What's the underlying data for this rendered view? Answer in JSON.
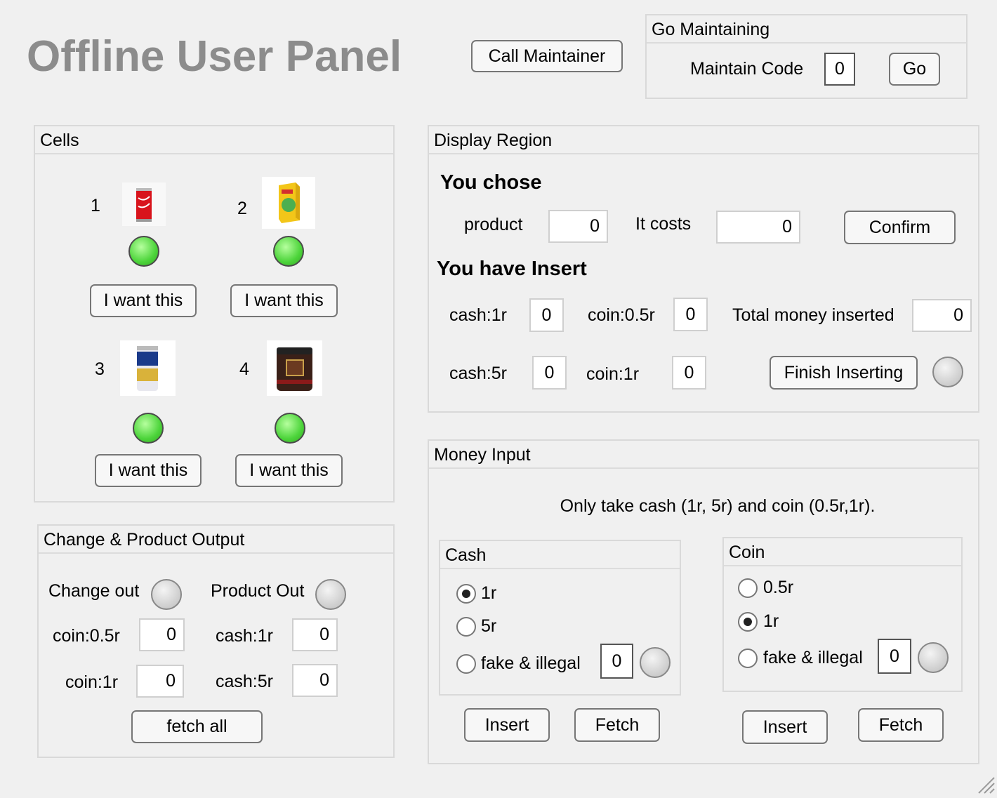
{
  "header": {
    "title": "Offline User Panel",
    "call_maintainer": "Call Maintainer"
  },
  "maintain": {
    "panel_title": "Go Maintaining",
    "code_label": "Maintain Code",
    "code_value": "0",
    "go_label": "Go"
  },
  "cells": {
    "panel_title": "Cells",
    "items": [
      {
        "number": "1",
        "button": "I want this",
        "icon": "cola-can-icon",
        "status": "green"
      },
      {
        "number": "2",
        "button": "I want this",
        "icon": "juice-box-icon",
        "status": "green"
      },
      {
        "number": "3",
        "button": "I want this",
        "icon": "milk-can-icon",
        "status": "green"
      },
      {
        "number": "4",
        "button": "I want this",
        "icon": "chocolate-jar-icon",
        "status": "green"
      }
    ]
  },
  "display": {
    "panel_title": "Display Region",
    "you_chose": "You chose",
    "product_label": "product",
    "product_value": "0",
    "costs_label": "It costs",
    "costs_value": "0",
    "confirm_label": "Confirm",
    "you_have_insert": "You have Insert",
    "cash1_label": "cash:1r",
    "cash1_value": "0",
    "coin05_label": "coin:0.5r",
    "coin05_value": "0",
    "total_label": "Total money inserted",
    "total_value": "0",
    "cash5_label": "cash:5r",
    "cash5_value": "0",
    "coin1_label": "coin:1r",
    "coin1_value": "0",
    "finish_label": "Finish Inserting"
  },
  "output": {
    "panel_title": "Change & Product Output",
    "change_out_label": "Change out",
    "product_out_label": "Product Out",
    "coin05_label": "coin:0.5r",
    "coin05_value": "0",
    "cash1_label": "cash:1r",
    "cash1_value": "0",
    "coin1_label": "coin:1r",
    "coin1_value": "0",
    "cash5_label": "cash:5r",
    "cash5_value": "0",
    "fetch_all_label": "fetch all"
  },
  "money_input": {
    "panel_title": "Money Input",
    "note": "Only take cash (1r, 5r) and coin (0.5r,1r).",
    "cash": {
      "panel_title": "Cash",
      "options": [
        "1r",
        "5r",
        "fake & illegal"
      ],
      "selected": "1r",
      "fake_value": "0",
      "insert_label": "Insert",
      "fetch_label": "Fetch"
    },
    "coin": {
      "panel_title": "Coin",
      "options": [
        "0.5r",
        "1r",
        "fake & illegal"
      ],
      "selected": "1r",
      "fake_value": "0",
      "insert_label": "Insert",
      "fetch_label": "Fetch"
    }
  },
  "colors": {
    "background": "#f0f0f0",
    "title_gray": "#8c8c8c",
    "lamp_green": "#4cd43a",
    "lamp_gray": "#d2d2d2"
  }
}
